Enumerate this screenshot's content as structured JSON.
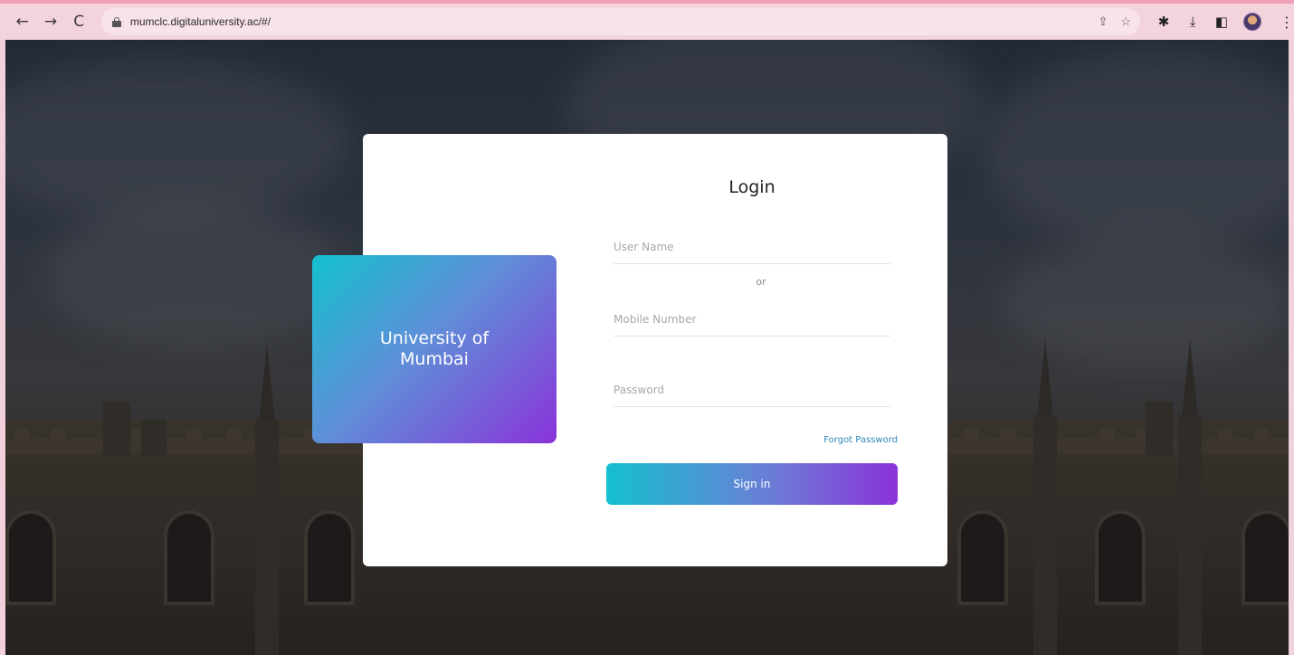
{
  "browser": {
    "back_icon": "←",
    "forward_icon": "→",
    "reload_icon": "C",
    "url": "mumclc.digitaluniversity.ac/#/",
    "share_icon": "⇪",
    "bookmark_icon": "☆",
    "extensions_icon": "✱",
    "download_icon": "⤓",
    "sidepanel_icon": "◧",
    "menu_icon": "⋮"
  },
  "brand": {
    "name": "University of Mumbai"
  },
  "login": {
    "title": "Login",
    "username_placeholder": "User Name",
    "or_text": "or",
    "mobile_placeholder": "Mobile Number",
    "password_placeholder": "Password",
    "forgot_label": "Forgot Password",
    "signin_label": "Sign in"
  },
  "colors": {
    "accent_start": "#14c0cf",
    "accent_end": "#8a33d9",
    "link": "#2f86b9"
  }
}
